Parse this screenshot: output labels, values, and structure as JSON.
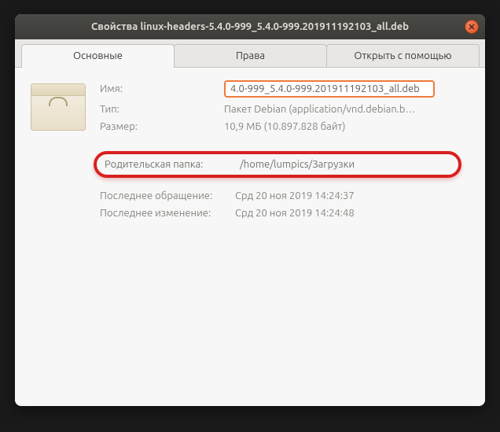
{
  "window": {
    "title": "Свойства linux-headers-5.4.0-999_5.4.0-999.201911192103_all.deb"
  },
  "tabs": {
    "basic": "Основные",
    "permissions": "Права",
    "openwith": "Открыть с помощью"
  },
  "labels": {
    "name": "Имя:",
    "type": "Тип:",
    "size": "Размер:",
    "parent_folder": "Родительская папка:",
    "accessed": "Последнее обращение:",
    "modified": "Последнее изменение:"
  },
  "values": {
    "name": "4.0-999_5.4.0-999.201911192103_all.deb",
    "type": "Пакет Debian (application/vnd.debian.b…",
    "size": "10,9 МБ (10.897.828 байт)",
    "parent_folder": "/home/lumpics/Загрузки",
    "accessed": "Срд 20 ноя 2019 14:24:37",
    "modified": "Срд 20 ноя 2019 14:24:48"
  }
}
